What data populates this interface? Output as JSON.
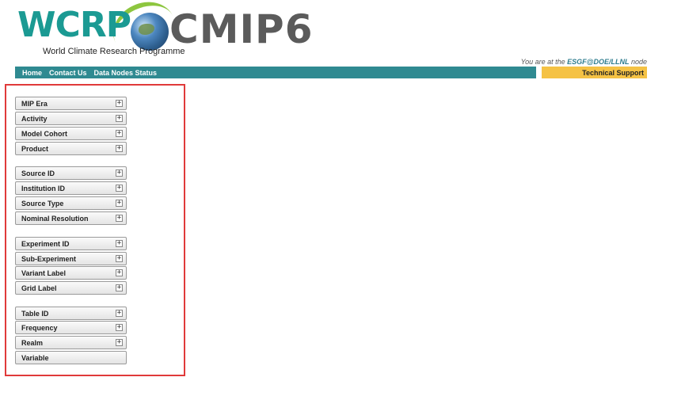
{
  "header": {
    "wcrp_logo_text": "WCRP",
    "wcrp_subtitle": "World Climate Research Programme",
    "cmip_logo_text": "CMIP6",
    "node_prefix": "You are at the",
    "node_id": "ESGF@DOE/LLNL",
    "node_suffix": "node"
  },
  "nav": {
    "items": [
      "Home",
      "Contact Us",
      "Data Nodes Status"
    ],
    "tech_support": "Technical Support"
  },
  "facets": {
    "group1": [
      "MIP Era",
      "Activity",
      "Model Cohort",
      "Product"
    ],
    "group2": [
      "Source ID",
      "Institution ID",
      "Source Type",
      "Nominal Resolution"
    ],
    "group3": [
      "Experiment ID",
      "Sub-Experiment",
      "Variant Label",
      "Grid Label"
    ],
    "group4": [
      "Table ID",
      "Frequency",
      "Realm",
      "Variable"
    ],
    "expand_icon": "plus-icon",
    "expand_symbol": "+"
  }
}
